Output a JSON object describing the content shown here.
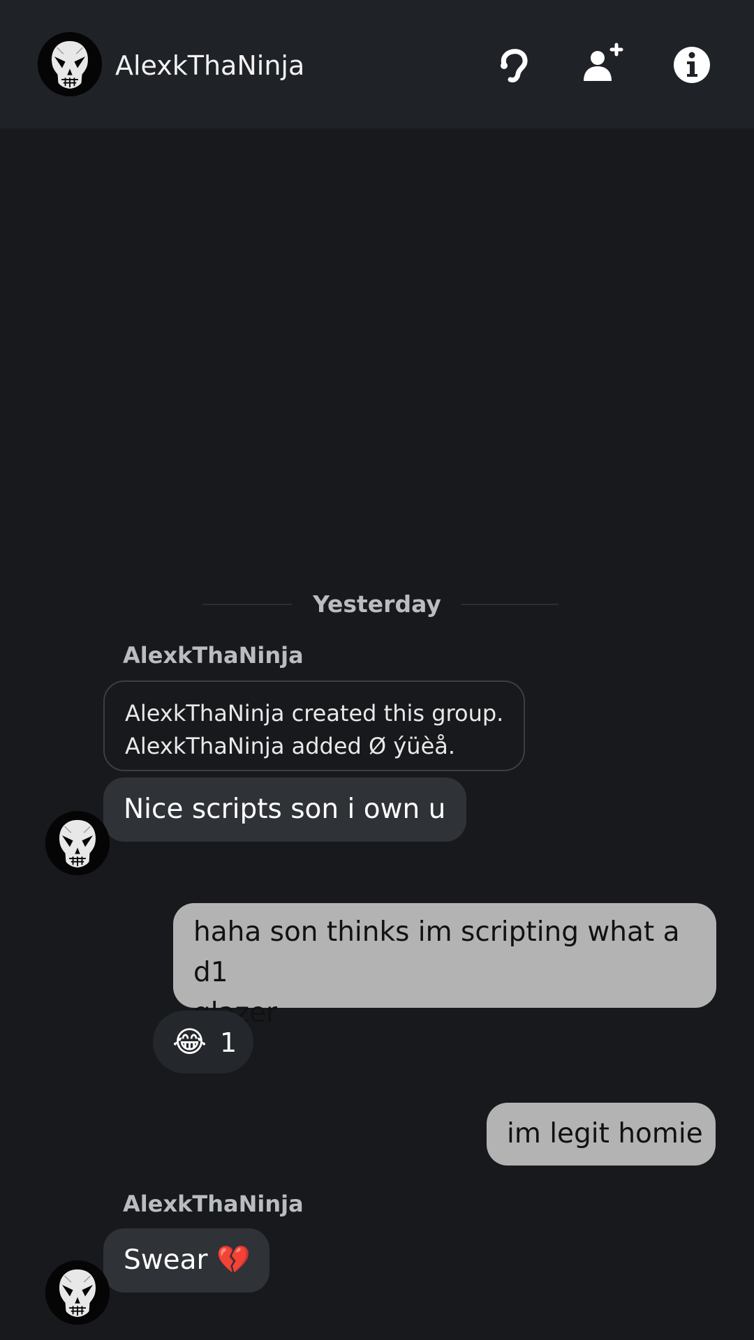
{
  "header": {
    "title": "AlexkThaNinja",
    "icons": [
      "voice-chat-icon",
      "add-friend-icon",
      "info-icon"
    ]
  },
  "chat": {
    "date_separator": "Yesterday",
    "messages": [
      {
        "type": "system",
        "sender": "AlexkThaNinja",
        "lines": [
          "AlexkThaNinja created this group.",
          "AlexkThaNinja added Ø ýüèå."
        ]
      },
      {
        "type": "incoming",
        "text": "Nice scripts  son i own u"
      },
      {
        "type": "outgoing",
        "lines": [
          "haha son thinks im scripting what a d1",
          "glazer"
        ],
        "reaction": {
          "emoji": "😂",
          "count": "1"
        }
      },
      {
        "type": "outgoing",
        "text": "im legit homie"
      },
      {
        "type": "incoming",
        "sender": "AlexkThaNinja",
        "text": "Swear 💔"
      }
    ]
  },
  "colors": {
    "background": "#17191c",
    "header": "#1f2226",
    "incoming_bubble": "#2f3236",
    "outgoing_bubble": "#b3b3b3",
    "meta_text": "#b9bcc0"
  }
}
